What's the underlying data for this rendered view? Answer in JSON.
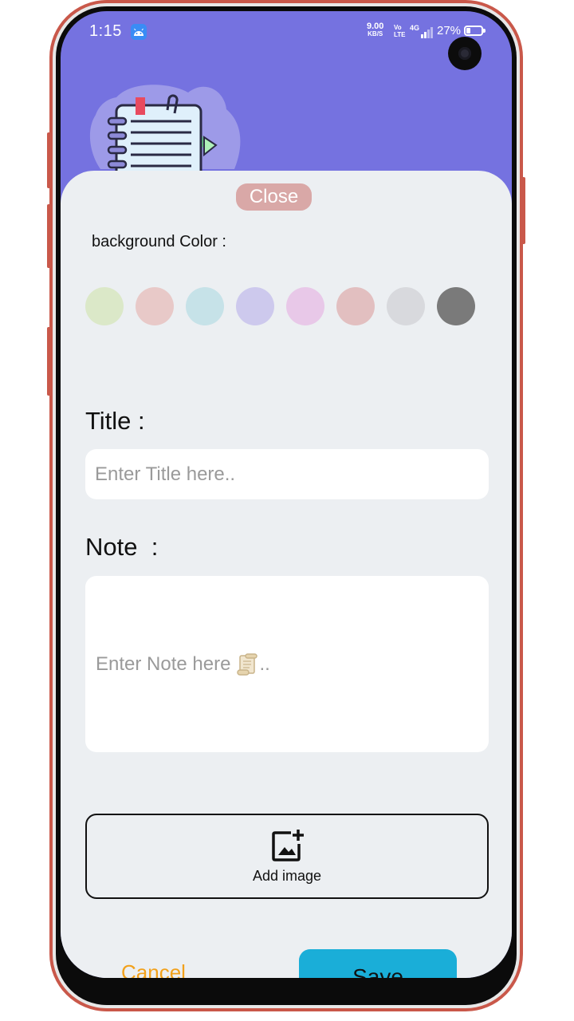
{
  "status_bar": {
    "time": "1:15",
    "net_speed": "9.00",
    "net_speed_unit": "KB/S",
    "volte": "Vo LTE",
    "network": "4G",
    "battery_percent": "27%",
    "battery_level": 0.27
  },
  "sheet": {
    "close_label": "Close",
    "background_color_label": "background Color :",
    "colors": [
      "#dbe8c8",
      "#e8c9c8",
      "#c6e2e8",
      "#cdc9ed",
      "#e8c8e8",
      "#e2bfc0",
      "#d8d9dd",
      "#7a7a7a"
    ],
    "title_label": "Title :",
    "title_placeholder": "Enter Title here..",
    "note_label": "Note  :",
    "note_placeholder": "Enter Note here",
    "note_placeholder_suffix": "..",
    "add_image_label": "Add image",
    "cancel_label": "Cancel",
    "save_label": "Save"
  },
  "accent_colors": {
    "header": "#7572e0",
    "cancel": "#f2a11b",
    "save": "#1aaed8",
    "close": "#d9a8a7"
  }
}
